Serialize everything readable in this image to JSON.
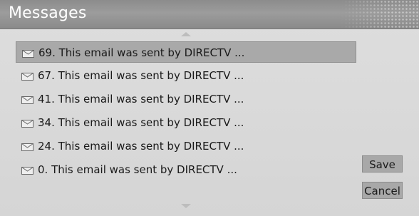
{
  "window": {
    "title": "Messages"
  },
  "messages": [
    {
      "text": "69.  This email was sent by DIRECTV ...",
      "selected": true
    },
    {
      "text": "67.  This email was sent by DIRECTV ...",
      "selected": false
    },
    {
      "text": "41.  This email was sent by DIRECTV ...",
      "selected": false
    },
    {
      "text": "34.  This email was sent by DIRECTV ...",
      "selected": false
    },
    {
      "text": "24.  This email was sent by DIRECTV ...",
      "selected": false
    },
    {
      "text": "0.  This email was sent by DIRECTV ...",
      "selected": false
    }
  ],
  "actions": {
    "save_label": "Save",
    "cancel_label": "Cancel"
  },
  "icons": {
    "message": "envelope-icon",
    "scroll_up": "scroll-up-arrow-icon",
    "scroll_down": "scroll-down-arrow-icon"
  },
  "colors": {
    "title_bar": "#8c8c8c",
    "background": "#d8d8d8",
    "selection": "#a9a9a9",
    "button": "#a8a8a8",
    "text": "#1a1a1a"
  }
}
